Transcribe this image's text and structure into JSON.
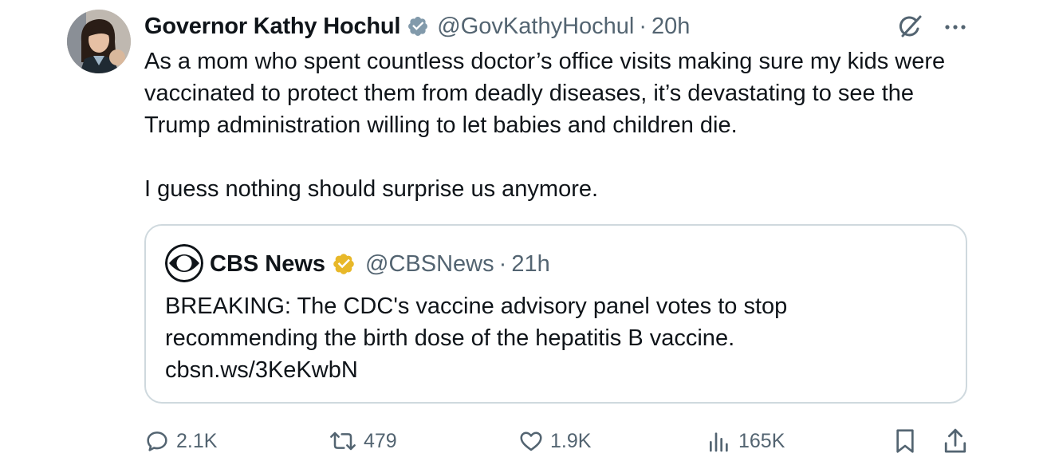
{
  "author": {
    "name": "Governor Kathy Hochul",
    "handle": "@GovKathyHochul",
    "separator": "·",
    "time": "20h",
    "verified_color": "#829aab"
  },
  "tweet": {
    "paragraphs": [
      "As a mom who spent countless doctor’s office visits making sure my kids were vaccinated to protect them from deadly diseases, it’s devastating to see the Trump administration willing to let babies and children die.",
      "I guess nothing should surprise us anymore."
    ]
  },
  "quote": {
    "name": "CBS News",
    "handle": "@CBSNews",
    "separator": "·",
    "time": "21h",
    "verified_color": "#e8b829",
    "lines": [
      "BREAKING: The CDC's vaccine advisory panel votes to stop",
      "recommending the birth dose of the hepatitis B vaccine.",
      "cbsn.ws/3KeKwbN"
    ]
  },
  "actions": {
    "replies": "2.1K",
    "reposts": "479",
    "likes": "1.9K",
    "views": "165K"
  },
  "colors": {
    "text": "#0f1419",
    "secondary": "#536471",
    "border": "#cfd9de"
  },
  "icons": [
    "grok-icon",
    "more-icon",
    "reply-icon",
    "repost-icon",
    "like-icon",
    "views-icon",
    "bookmark-icon",
    "share-icon"
  ]
}
